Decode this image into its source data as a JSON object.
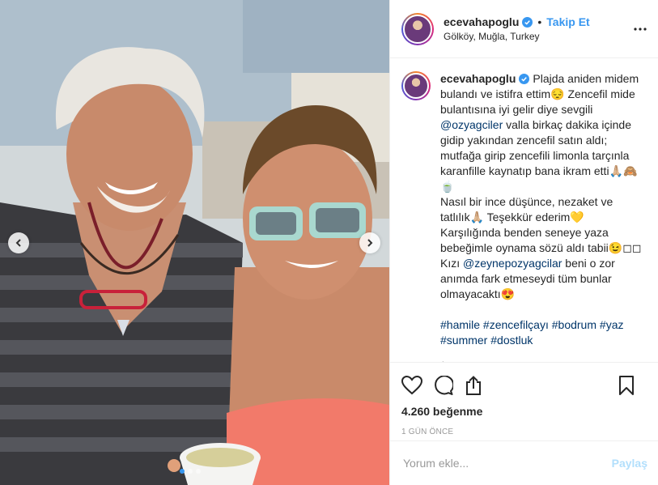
{
  "post": {
    "username": "ecevahapoglu",
    "follow_label": "Takip Et",
    "location": "Gölköy, Muğla, Turkey",
    "caption": {
      "p1": "Plajda aniden midem bulandı ve istifra ettim😔 Zencefil mide bulantısına iyi gelir diye sevgili",
      "mention1": "@ozyagciler",
      "p2": " valla birkaç dakika içinde gidip yakından zencefil satın aldı; mutfağa girip zencefili limonla tarçınla karanfille kaynatıp bana ikram etti🙏🏼🙈🍵",
      "p3": "Nasıl bir ince düşünce, nezaket ve tatlılık🙏🏼 Teşekkür ederim💛",
      "p4": "Karşılığında benden seneye yaza bebeğimle oynama sözü aldı tabii😉◻◻",
      "p5a": "Kızı ",
      "mention2": "@zeynepozyagcilar",
      "p5b": " beni o zor anımda fark etmeseydi tüm bunlar olmayacaktı😍",
      "tags": [
        "#hamile",
        "#zencefilçayı",
        "#bodrum",
        "#yaz",
        "#summer",
        "#dostluk"
      ],
      "age": "1g"
    },
    "likes": "4.260 beğenme",
    "posted_ago": "1 GÜN ÖNCE",
    "comment_placeholder": "Yorum ekle...",
    "share_label": "Paylaş",
    "carousel": {
      "count": 3,
      "active": 0
    }
  },
  "colors": {
    "accent": "#3897f0",
    "link": "#003569",
    "muted": "#999999"
  },
  "icons": [
    "chevron-left-icon",
    "chevron-right-icon",
    "verified-badge-icon",
    "more-options-icon",
    "heart-icon",
    "comment-icon",
    "share-icon",
    "bookmark-icon"
  ]
}
